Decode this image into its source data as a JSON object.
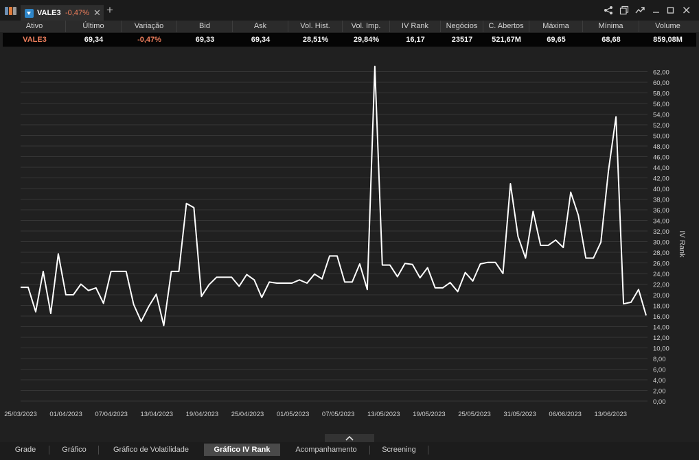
{
  "tab": {
    "symbol": "VALE3",
    "change": "-0,47%",
    "close": "✕",
    "add": "+"
  },
  "window_controls": {
    "share": "⋖",
    "restore_view": "⧉",
    "trend": "↗",
    "minimize": "—",
    "maximize": "☐",
    "close": "✕"
  },
  "quote": {
    "headers": [
      "Ativo",
      "Último",
      "Variação",
      "Bid",
      "Ask",
      "Vol. Hist.",
      "Vol. Imp.",
      "IV Rank",
      "Negócios",
      "C. Abertos",
      "Máxima",
      "Mínima",
      "Volume"
    ],
    "row": [
      "VALE3",
      "69,34",
      "-0,47%",
      "69,33",
      "69,34",
      "28,51%",
      "29,84%",
      "16,17",
      "23517",
      "521,67M",
      "69,65",
      "68,68",
      "859,08M"
    ]
  },
  "colors": {
    "negative": "#ee7e5c",
    "line": "#ffffff",
    "background": "#202020"
  },
  "chart_data": {
    "type": "line",
    "ylabel": "IV Rank",
    "ylim": [
      0,
      63
    ],
    "y_ticks": [
      "0,00",
      "2,00",
      "4,00",
      "6,00",
      "8,00",
      "10,00",
      "12,00",
      "14,00",
      "16,00",
      "18,00",
      "20,00",
      "22,00",
      "24,00",
      "26,00",
      "28,00",
      "30,00",
      "32,00",
      "34,00",
      "36,00",
      "38,00",
      "40,00",
      "42,00",
      "44,00",
      "46,00",
      "48,00",
      "50,00",
      "52,00",
      "54,00",
      "56,00",
      "58,00",
      "60,00",
      "62,00"
    ],
    "x_ticks": [
      "25/03/2023",
      "01/04/2023",
      "07/04/2023",
      "13/04/2023",
      "19/04/2023",
      "25/04/2023",
      "01/05/2023",
      "07/05/2023",
      "13/05/2023",
      "19/05/2023",
      "25/05/2023",
      "31/05/2023",
      "06/06/2023",
      "13/06/2023"
    ],
    "grid": true,
    "series": [
      {
        "values": [
          21.4,
          21.4,
          16.8,
          24.4,
          16.5,
          27.7,
          20.0,
          20.0,
          22.0,
          20.8,
          21.3,
          18.4,
          24.4,
          24.4,
          24.4,
          18.2,
          15.0,
          17.8,
          20.1,
          14.2,
          24.4,
          24.4,
          37.2,
          36.4,
          19.7,
          21.9,
          23.3,
          23.3,
          23.3,
          21.6,
          23.8,
          22.8,
          19.5,
          22.4,
          22.2,
          22.2,
          22.2,
          22.8,
          22.2,
          23.9,
          23.0,
          27.3,
          27.3,
          22.4,
          22.4,
          25.8,
          21.0,
          63.0,
          25.6,
          25.6,
          23.4,
          25.9,
          25.7,
          23.2,
          25.1,
          21.3,
          21.3,
          22.3,
          20.6,
          24.2,
          22.6,
          25.8,
          26.1,
          26.1,
          24.0,
          40.9,
          31.0,
          26.9,
          35.7,
          29.3,
          29.3,
          30.3,
          28.9,
          39.3,
          35.0,
          26.9,
          26.9,
          29.9,
          43.3,
          53.5,
          18.3,
          18.6,
          21.0,
          16.1
        ]
      }
    ]
  },
  "bottom_tabs": [
    "Grade",
    "Gráfico",
    "Gráfico de Volatilidade",
    "Gráfico IV Rank",
    "Acompanhamento",
    "Screening"
  ],
  "active_bottom_tab": "Gráfico IV Rank"
}
